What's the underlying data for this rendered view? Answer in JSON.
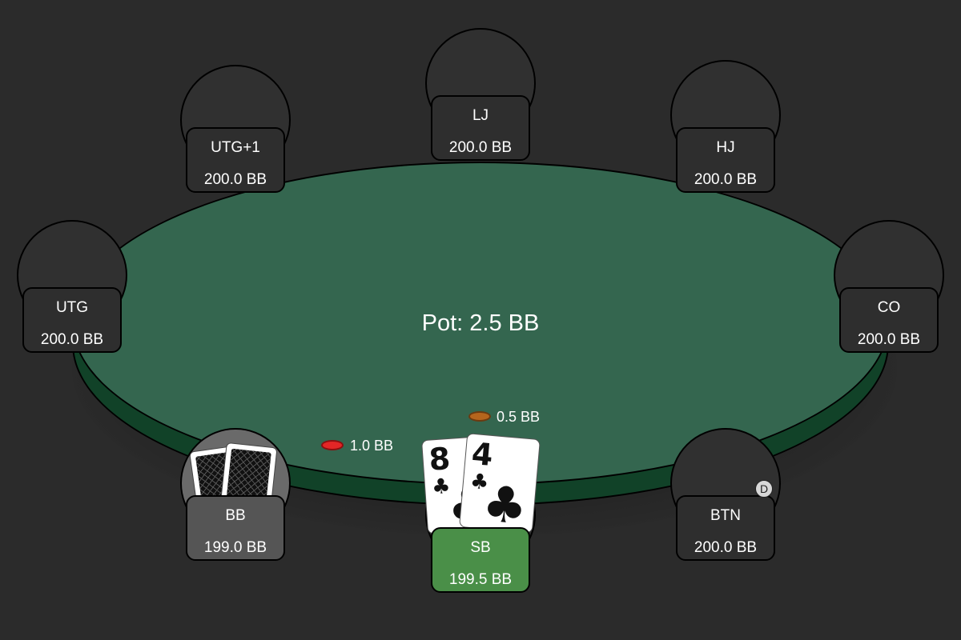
{
  "pot": {
    "label": "Pot: 2.5 BB"
  },
  "seats": {
    "utg1": {
      "position": "UTG+1",
      "stack": "200.0 BB"
    },
    "lj": {
      "position": "LJ",
      "stack": "200.0 BB"
    },
    "hj": {
      "position": "HJ",
      "stack": "200.0 BB"
    },
    "utg": {
      "position": "UTG",
      "stack": "200.0 BB"
    },
    "co": {
      "position": "CO",
      "stack": "200.0 BB"
    },
    "bb": {
      "position": "BB",
      "stack": "199.0 BB"
    },
    "sb": {
      "position": "SB",
      "stack": "199.5 BB"
    },
    "btn": {
      "position": "BTN",
      "stack": "200.0 BB"
    }
  },
  "bets": {
    "bb": {
      "amount": "1.0 BB",
      "chip_color": "#e32626"
    },
    "sb": {
      "amount": "0.5 BB",
      "chip_color": "#b5651d"
    }
  },
  "dealer_button": {
    "label": "D",
    "seat": "BTN"
  },
  "hero": {
    "seat": "SB",
    "cards": [
      {
        "rank": "8",
        "suit": "♣",
        "suit_name": "clubs"
      },
      {
        "rank": "4",
        "suit": "♣",
        "suit_name": "clubs"
      }
    ]
  },
  "bb_hand": {
    "face_down_cards": 2
  },
  "colors": {
    "felt": "#34664f",
    "rim": "#114228",
    "background": "#2b2b2b",
    "hero_highlight": "#4a8f48",
    "bb_highlight": "#555555"
  }
}
